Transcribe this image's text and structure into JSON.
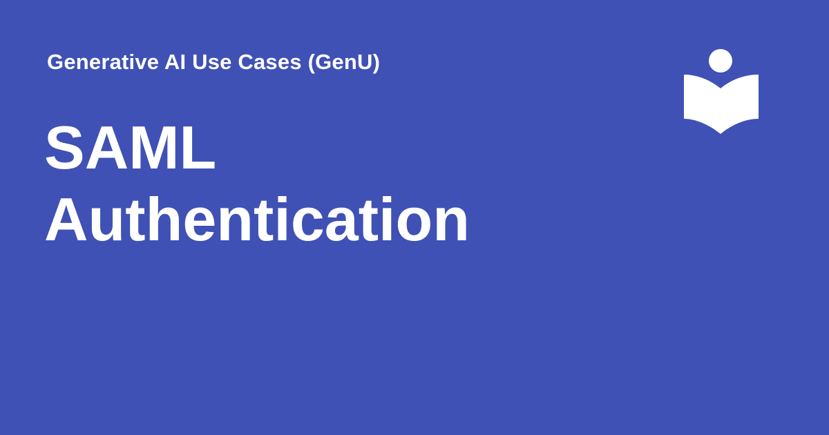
{
  "header": {
    "site_name": "Generative AI Use Cases (GenU)"
  },
  "main": {
    "title_lines": [
      "SAML",
      "Authentication"
    ]
  },
  "logo": {
    "icon": "open-book-reader-icon"
  },
  "colors": {
    "background": "#3f51b5",
    "text": "#ffffff"
  }
}
